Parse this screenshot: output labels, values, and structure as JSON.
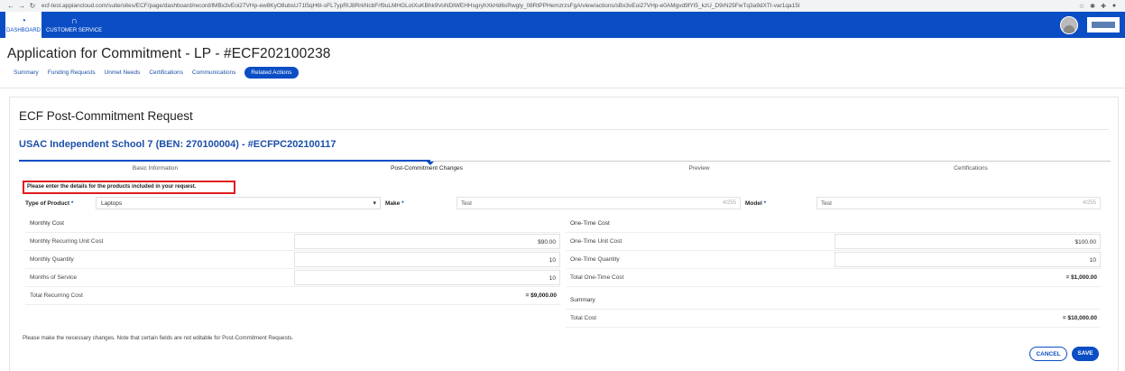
{
  "browser": {
    "url": "ecf-test.appiancloud.com/suite/sites/ECF/page/dashboard/record/lMBx3vEoi27VHp-ew8KyO8ubsU71l5qH6I-sFL7ypRIJ8RrkNcbFrf9uLMHGLotXuKBhk9VoNDlWEHHsgryhXkHd6sRwgly_08RtPPHemzrzsFgA/view/actions/sBx3vEoi27VHp-e0AMgvd9fYl5_kzU_D9rN25FwTq3a9dXTI-var1qa15I",
    "back_icon": "arrow-left-icon",
    "forward_icon": "arrow-right-icon",
    "reload_icon": "reload-icon"
  },
  "appbar": {
    "tabs": [
      {
        "label": "DASHBOARD",
        "icon": "dashboard-icon"
      },
      {
        "label": "CUSTOMER SERVICE",
        "icon": "headset-icon"
      }
    ]
  },
  "page": {
    "title": "Application for Commitment - LP - #ECF202100238",
    "tabs": [
      "Summary",
      "Funding Requests",
      "Unmet Needs",
      "Certifications",
      "Communications",
      "Related Actions"
    ],
    "active_tab": "Related Actions"
  },
  "card": {
    "title": "ECF Post-Commitment Request",
    "entity": "USAC Independent School 7 (BEN: 270100004) - #ECFPC202100117",
    "steps": [
      "Basic Information",
      "Post-Commitment Changes",
      "Preview",
      "Certifications"
    ],
    "current_step": "Post-Commitment Changes",
    "instruction": "Please enter the details for the products included in your request.",
    "product": {
      "type_label": "Type of Product",
      "type_value": "Laptops",
      "make_label": "Make",
      "make_value": "Test",
      "make_count": "4/255",
      "model_label": "Model",
      "model_value": "Test",
      "model_count": "4/255",
      "required_mark": "*"
    },
    "monthly": {
      "header": "Monthly Cost",
      "unit_cost_label": "Monthly Recurring Unit Cost",
      "unit_cost_value": "$90.00",
      "quantity_label": "Monthly Quantity",
      "quantity_value": "10",
      "months_label": "Months of Service",
      "months_value": "10",
      "total_label": "Total Recurring Cost",
      "total_value": "= $9,000.00"
    },
    "onetime": {
      "header": "One-Time Cost",
      "unit_cost_label": "One-Time Unit Cost",
      "unit_cost_value": "$100.00",
      "quantity_label": "One-Time Quantity",
      "quantity_value": "10",
      "total_label": "Total One-Time Cost",
      "total_value": "= $1,000.00"
    },
    "summary": {
      "header": "Summary",
      "total_label": "Total Cost",
      "total_value": "= $10,000.00"
    },
    "note": "Please make the necessary changes. Note that certain fields are not editable for Post-Commitment Requests.",
    "cancel_label": "CANCEL",
    "save_label": "SAVE"
  }
}
